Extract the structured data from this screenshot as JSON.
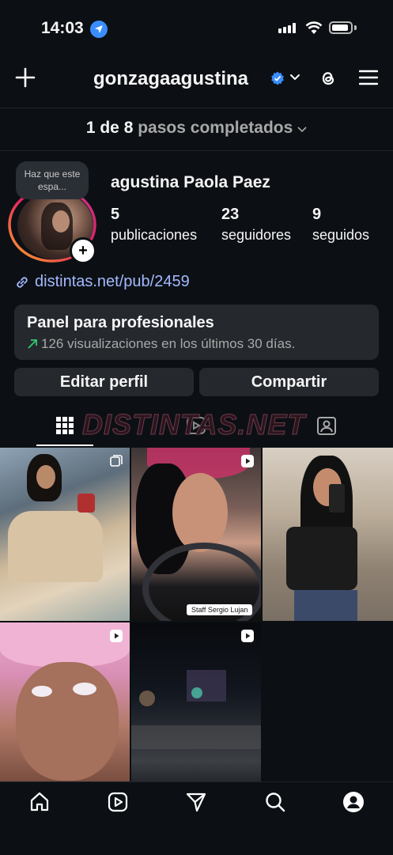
{
  "status": {
    "time": "14:03"
  },
  "header": {
    "username": "gonzagaagustina"
  },
  "steps": {
    "count": "1 de 8",
    "label": "pasos completados"
  },
  "profile": {
    "note": "Haz que este espa...",
    "full_name": "agustina Paola Paez",
    "stats": [
      {
        "value": "5",
        "label": "publicaciones"
      },
      {
        "value": "23",
        "label": "seguidores"
      },
      {
        "value": "9",
        "label": "seguidos"
      }
    ],
    "link": "distintas.net/pub/2459"
  },
  "panel": {
    "title": "Panel para profesionales",
    "subtitle": "126 visualizaciones en los últimos 30 días."
  },
  "buttons": {
    "edit": "Editar perfil",
    "share": "Compartir"
  },
  "watermark": "DISTINTAS.NET",
  "posts": [
    {
      "type": "carousel"
    },
    {
      "type": "reel",
      "tag": "Staff Sergio Lujan"
    },
    {
      "type": "photo"
    },
    {
      "type": "reel"
    },
    {
      "type": "reel"
    }
  ],
  "colors": {
    "background": "#0c1014",
    "link": "#a3b8ff",
    "verified": "#3a8dff",
    "surface": "#25292e"
  }
}
